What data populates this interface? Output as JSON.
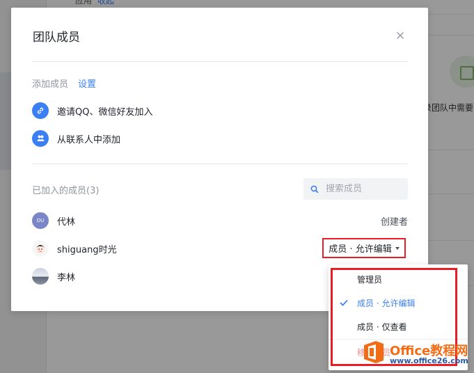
{
  "background": {
    "tab_label": "应用",
    "tab_accent": "收起",
    "feature_text": "录团队中需要"
  },
  "modal": {
    "title": "团队成员",
    "add_section": {
      "label": "添加成员",
      "settings_link": "设置",
      "actions": [
        {
          "label": "邀请QQ、微信好友加入",
          "icon": "link-icon"
        },
        {
          "label": "从联系人中添加",
          "icon": "contacts-icon"
        }
      ]
    },
    "members_section": {
      "label": "已加入的成员(3)",
      "search_placeholder": "搜索成员"
    },
    "members": [
      {
        "name": "代林",
        "avatar_text": "OU",
        "avatar_color": "#7a86c8",
        "role": "创建者"
      },
      {
        "name": "shiguang时光",
        "role": "成员 · 允许编辑"
      },
      {
        "name": "李林",
        "role": ""
      }
    ]
  },
  "role_menu": {
    "items": [
      {
        "label": "管理员",
        "selected": false
      },
      {
        "label": "成员 · 允许编辑",
        "selected": true
      },
      {
        "label": "成员 · 仅查看",
        "selected": false
      }
    ],
    "faded_item": "移除成员"
  },
  "watermark": {
    "title": "Office教程网",
    "url": "www.office26.com"
  },
  "colors": {
    "accent": "#3b7ff4",
    "highlight_red": "#ea1d24",
    "watermark_orange": "#f26c16"
  }
}
